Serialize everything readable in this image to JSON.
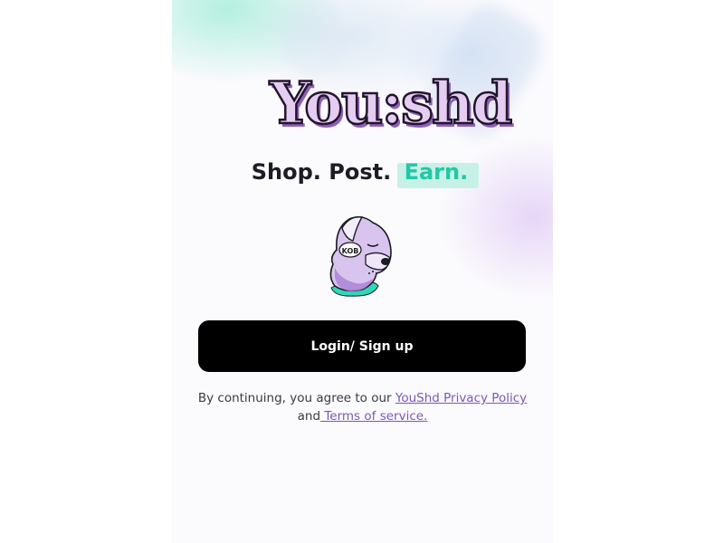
{
  "brand": {
    "logo_text": "You:shd",
    "logo_colors": {
      "fill": "#e4cdf1",
      "outline": "#23152e",
      "shadow": "#8e5fb8",
      "dot": "#33d9b6"
    }
  },
  "tagline": {
    "part1": "Shop.",
    "part2": "Post.",
    "part3": "Earn.",
    "accent_color": "#22c7a6"
  },
  "mascot": {
    "icon": "dog-mascot-icon",
    "eye_text": "KOB"
  },
  "actions": {
    "login_label": "Login/ Sign up"
  },
  "legal": {
    "prefix": "By continuing, you agree to our ",
    "privacy_link": "YouShd Privacy Policy ",
    "conjunction": "and",
    "terms_link": " Terms of service."
  }
}
